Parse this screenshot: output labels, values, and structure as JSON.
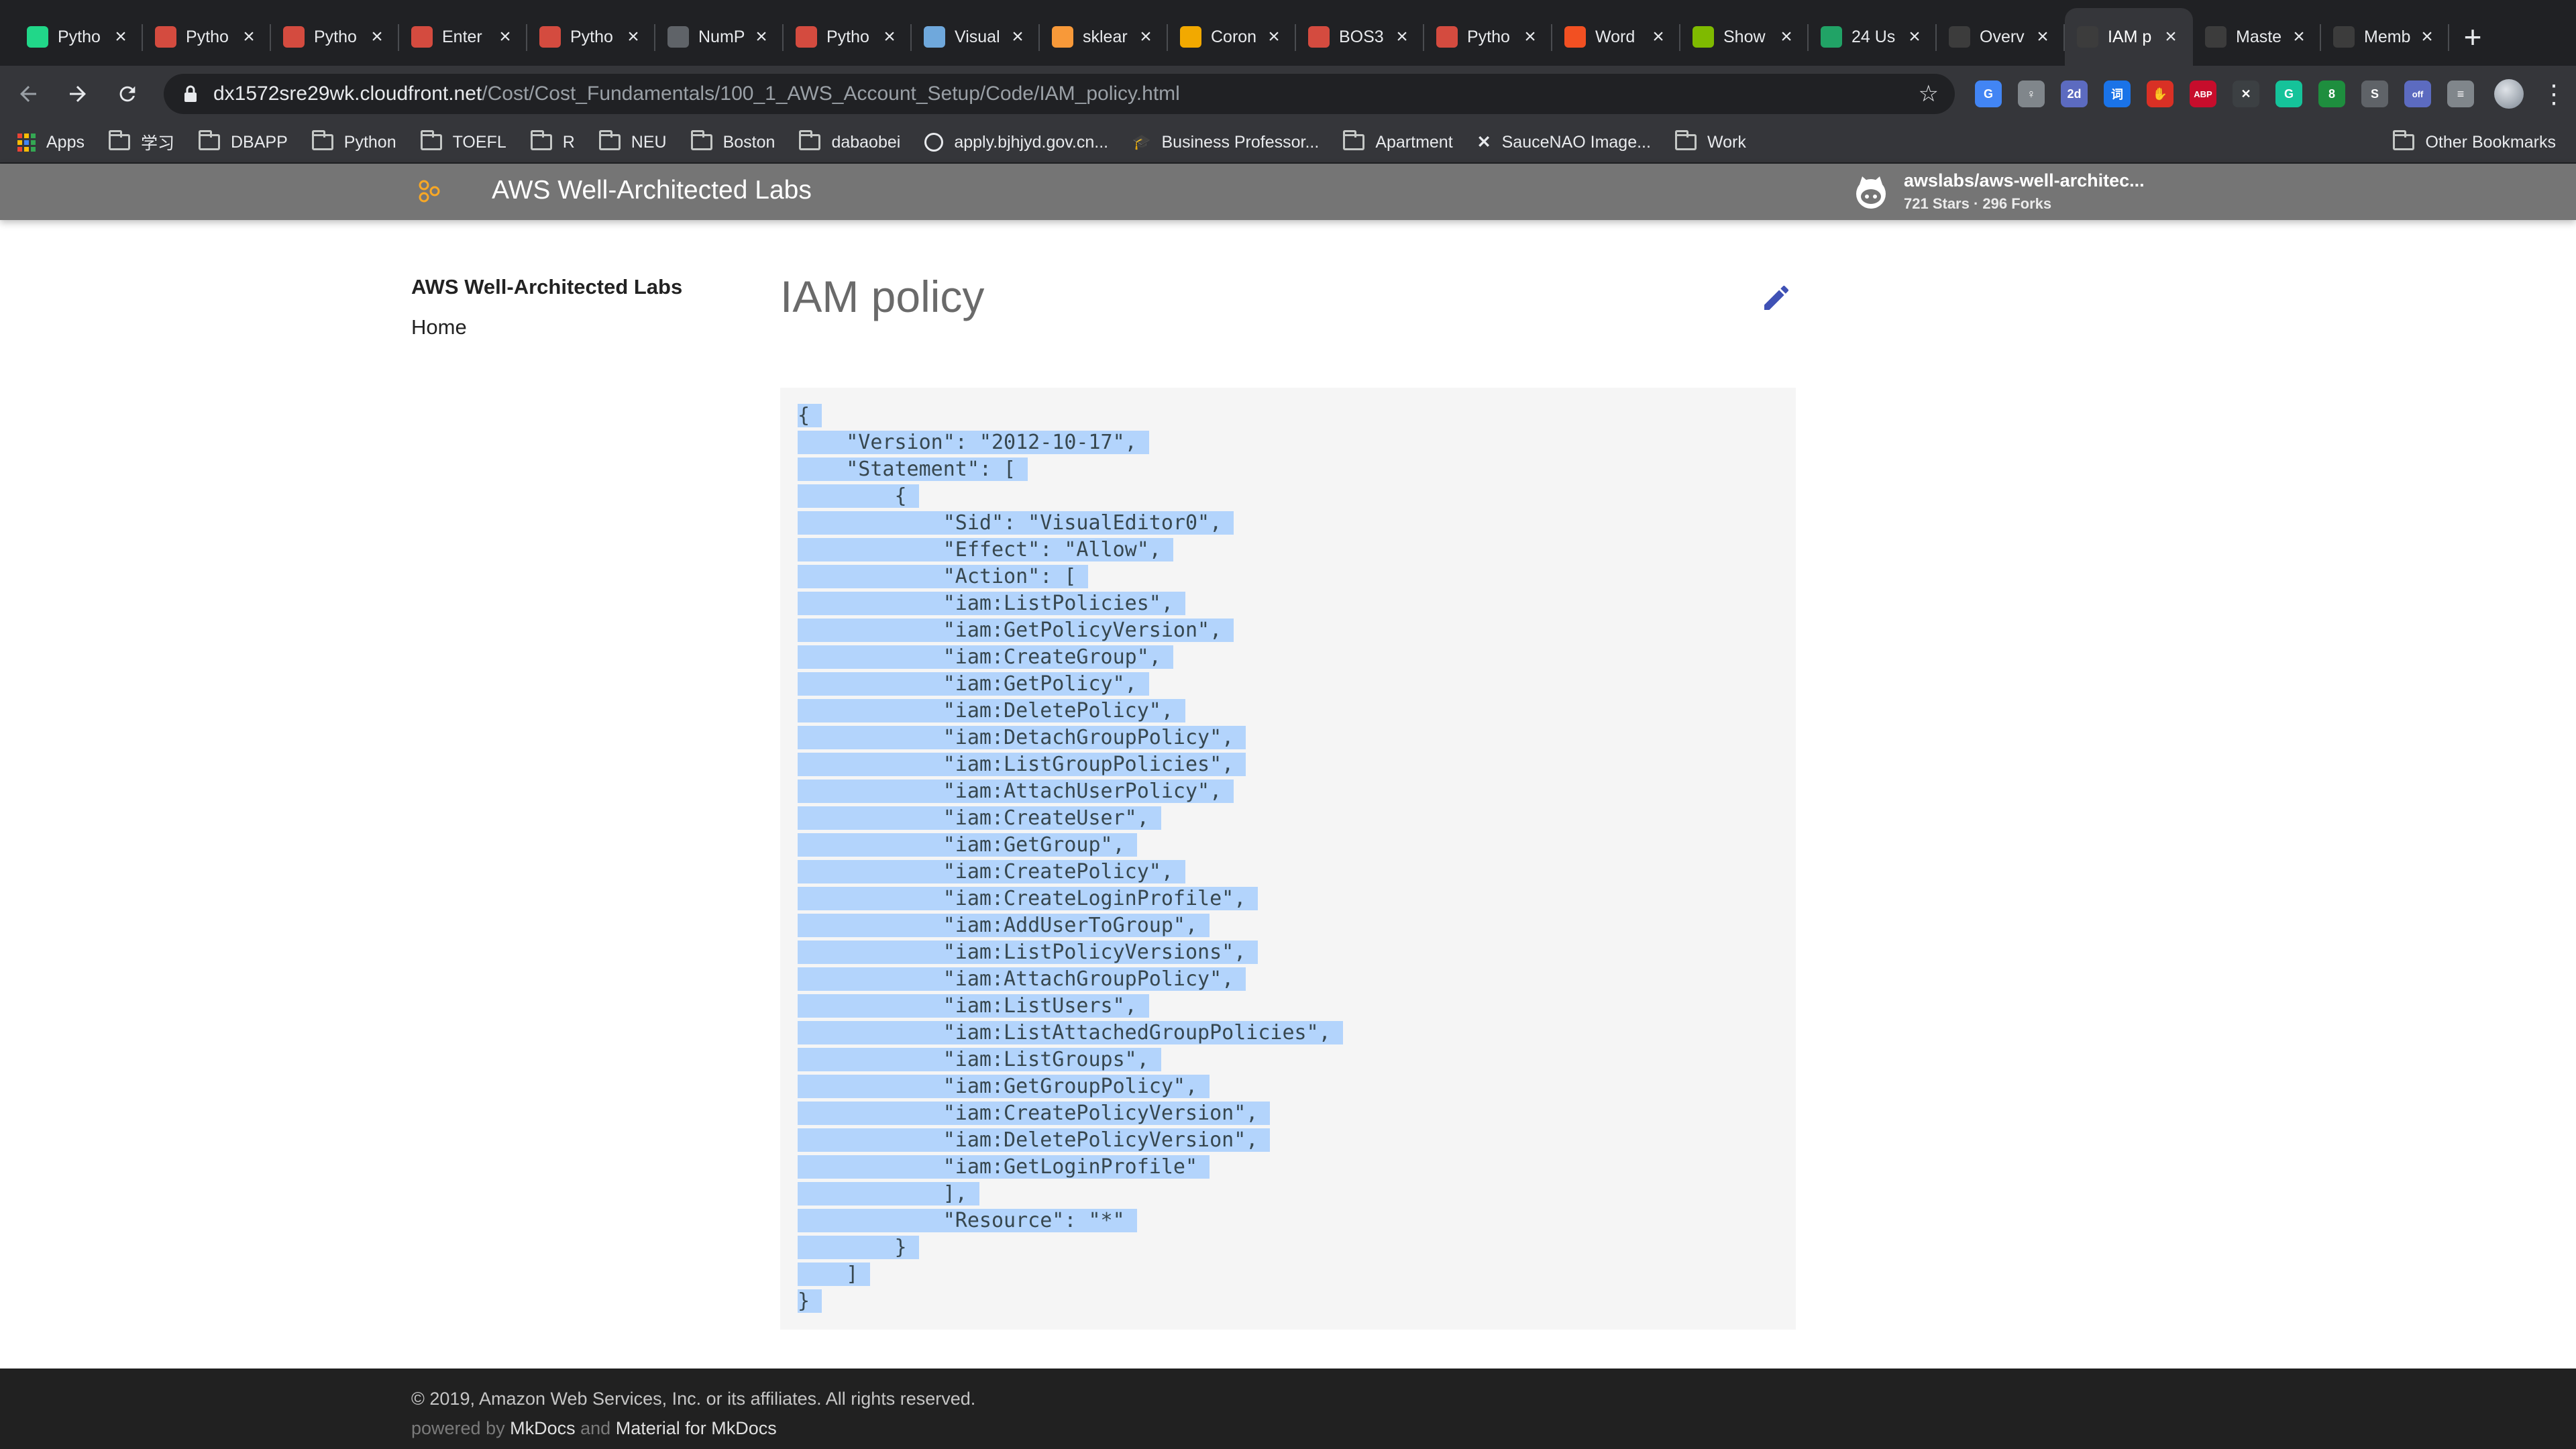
{
  "browser": {
    "tabs": [
      {
        "title": "Pytho",
        "favicon": "green-pycharm-icon",
        "color": "#21d789"
      },
      {
        "title": "Pytho",
        "favicon": "red-bug-icon",
        "color": "#d44b3f"
      },
      {
        "title": "Pytho",
        "favicon": "red-bug-icon",
        "color": "#d44b3f"
      },
      {
        "title": "Enter",
        "favicon": "red-bug-icon",
        "color": "#d44b3f"
      },
      {
        "title": "Pytho",
        "favicon": "red-bug-icon",
        "color": "#d44b3f"
      },
      {
        "title": "NumP",
        "favicon": "globe-icon",
        "color": "#5f6368"
      },
      {
        "title": "Pytho",
        "favicon": "red-bug-icon",
        "color": "#d44b3f"
      },
      {
        "title": "Visual",
        "favicon": "shield-icon",
        "color": "#6fa8dc"
      },
      {
        "title": "sklear",
        "favicon": "sklearn-icon",
        "color": "#f89939"
      },
      {
        "title": "Coron",
        "favicon": "coronavirus-icon",
        "color": "#f2a900"
      },
      {
        "title": "BOS3",
        "favicon": "red-bug-icon",
        "color": "#d44b3f"
      },
      {
        "title": "Pytho",
        "favicon": "red-bug-icon",
        "color": "#d44b3f"
      },
      {
        "title": "Word",
        "favicon": "microsoft-icon",
        "color": "#f25022"
      },
      {
        "title": "Show",
        "favicon": "microsoft-icon",
        "color": "#7fba00"
      },
      {
        "title": "24 Us",
        "favicon": "excel-x-icon",
        "color": "#21a366"
      },
      {
        "title": "Overv",
        "favicon": "mortarboard-icon",
        "color": "#3c3c3c"
      },
      {
        "title": "IAM p",
        "favicon": "mortarboard-icon",
        "color": "#3c3c3c",
        "active": true
      },
      {
        "title": "Maste",
        "favicon": "mortarboard-icon",
        "color": "#3c3c3c"
      },
      {
        "title": "Memb",
        "favicon": "mortarboard-icon",
        "color": "#3c3c3c"
      }
    ],
    "new_tab_label": "+",
    "url_host": "dx1572sre29wk.cloudfront.net",
    "url_path": "/Cost/Cost_Fundamentals/100_1_AWS_Account_Setup/Code/IAM_policy.html",
    "extensions": [
      {
        "name": "google-translate-icon",
        "color": "#4285f4",
        "label": "G"
      },
      {
        "name": "lightbulb-icon",
        "color": "#80868b",
        "label": "♀"
      },
      {
        "name": "calendar-2d-icon",
        "color": "#5c6bc0",
        "label": "2d"
      },
      {
        "name": "dictionary-icon",
        "color": "#1a73e8",
        "label": "词"
      },
      {
        "name": "redfinger-icon",
        "color": "#d93025",
        "label": "✋"
      },
      {
        "name": "adblock-plus-icon",
        "color": "#c70d2c",
        "label": "ABP"
      },
      {
        "name": "x-extension-icon",
        "color": "#3c4043",
        "label": "✕"
      },
      {
        "name": "grammarly-icon",
        "color": "#15c39a",
        "label": "G"
      },
      {
        "name": "green-extension-icon",
        "color": "#1e8e3e",
        "label": "8"
      },
      {
        "name": "spiral-icon",
        "color": "#5f6368",
        "label": "S"
      },
      {
        "name": "calendar-off-icon",
        "color": "#5c6bc0",
        "label": "off"
      },
      {
        "name": "reading-list-icon",
        "color": "#80868b",
        "label": "≡"
      }
    ],
    "bookmarks": [
      {
        "label": "Apps",
        "type": "apps"
      },
      {
        "label": "学习",
        "type": "folder"
      },
      {
        "label": "DBAPP",
        "type": "folder"
      },
      {
        "label": "Python",
        "type": "folder"
      },
      {
        "label": "TOEFL",
        "type": "folder"
      },
      {
        "label": "R",
        "type": "folder"
      },
      {
        "label": "NEU",
        "type": "folder"
      },
      {
        "label": "Boston",
        "type": "folder"
      },
      {
        "label": "dabaobei",
        "type": "folder"
      },
      {
        "label": "apply.bjhjyd.gov.cn...",
        "type": "globe"
      },
      {
        "label": "Business Professor...",
        "type": "person"
      },
      {
        "label": "Apartment",
        "type": "folder"
      },
      {
        "label": "SauceNAO Image...",
        "type": "sauce"
      },
      {
        "label": "Work",
        "type": "folder"
      }
    ],
    "other_bookmarks": "Other Bookmarks"
  },
  "site": {
    "title": "AWS Well-Architected Labs",
    "repo_name": "awslabs/aws-well-architec...",
    "repo_stats": "721 Stars · 296 Forks",
    "accent": "#757575"
  },
  "sidebar": {
    "title": "AWS Well-Architected Labs",
    "home": "Home"
  },
  "content": {
    "title": "IAM policy",
    "edit_color": "#3f51b5",
    "code_lines": [
      "{",
      "    \"Version\": \"2012-10-17\",",
      "    \"Statement\": [",
      "        {",
      "            \"Sid\": \"VisualEditor0\",",
      "            \"Effect\": \"Allow\",",
      "            \"Action\": [",
      "            \"iam:ListPolicies\",",
      "            \"iam:GetPolicyVersion\",",
      "            \"iam:CreateGroup\",",
      "            \"iam:GetPolicy\",",
      "            \"iam:DeletePolicy\",",
      "            \"iam:DetachGroupPolicy\",",
      "            \"iam:ListGroupPolicies\",",
      "            \"iam:AttachUserPolicy\",",
      "            \"iam:CreateUser\",",
      "            \"iam:GetGroup\",",
      "            \"iam:CreatePolicy\",",
      "            \"iam:CreateLoginProfile\",",
      "            \"iam:AddUserToGroup\",",
      "            \"iam:ListPolicyVersions\",",
      "            \"iam:AttachGroupPolicy\",",
      "            \"iam:ListUsers\",",
      "            \"iam:ListAttachedGroupPolicies\",",
      "            \"iam:ListGroups\",",
      "            \"iam:GetGroupPolicy\",",
      "            \"iam:CreatePolicyVersion\",",
      "            \"iam:DeletePolicyVersion\",",
      "            \"iam:GetLoginProfile\"",
      "            ],",
      "            \"Resource\": \"*\"",
      "        }",
      "    ]",
      "}"
    ],
    "selection_color": "#b3d4fc"
  },
  "footer": {
    "copyright": "© 2019, Amazon Web Services, Inc. or its affiliates. All rights reserved.",
    "powered_by": "powered by",
    "mkdocs": "MkDocs",
    "and": "and",
    "material": "Material for MkDocs"
  }
}
